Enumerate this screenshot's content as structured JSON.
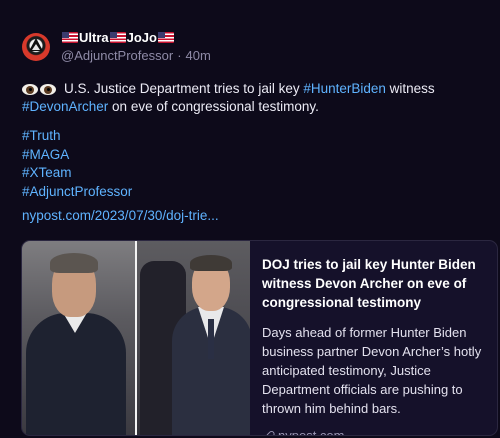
{
  "author": {
    "display_name_core_1": "Ultra",
    "display_name_core_2": "JoJo",
    "handle": "@AdjunctProfessor",
    "separator": "·",
    "time": "40m"
  },
  "post": {
    "line1_prefix": "U.S. Justice Department tries to jail key ",
    "line1_tag": "#HunterBiden",
    "line1_suffix": " witness",
    "line2_tag": "#DevonArcher",
    "line2_suffix": " on eve of congressional testimony.",
    "hashtags": [
      "#Truth",
      "#MAGA",
      "#XTeam",
      "#AdjunctProfessor"
    ],
    "url": "nypost.com/2023/07/30/doj-trie..."
  },
  "card": {
    "title": "DOJ tries to jail key Hunter Biden witness Devon Archer on eve of congressional testimony",
    "description": "Days ahead of former Hunter Biden business partner Devon Archer’s hotly anticipated testimony, Justice Department officials are pushing to thrown him behind bars.",
    "source": "nypost.com"
  },
  "icons": {
    "avatar": "illuminati-eye-avatar",
    "eyes": "eyes-emoji",
    "flag": "us-flag-emoji",
    "link": "link-icon"
  },
  "colors": {
    "background": "#0d0a1a",
    "link": "#5fb3ff",
    "muted": "#8e8aa6"
  }
}
